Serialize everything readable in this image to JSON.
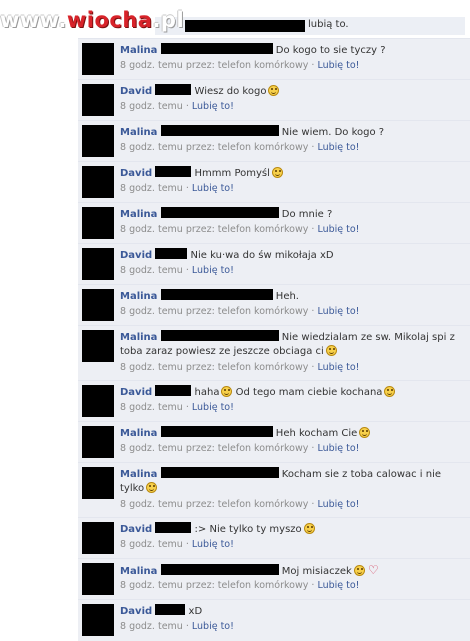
{
  "watermark": {
    "prefix": "www.",
    "brand": "wiocha",
    "suffix": ".pl"
  },
  "top": {
    "text": "lubią to."
  },
  "meta_like": "Lubię to!",
  "comments": [
    {
      "name": "Malina",
      "text": "Do kogo to sie tyczy ?",
      "meta": "8 godz. temu przez: telefon komórkowy ·"
    },
    {
      "name": "David",
      "text": "Wiesz do kogo",
      "meta": "8 godz. temu ·"
    },
    {
      "name": "Malina",
      "text": "Nie wiem. Do kogo ?",
      "meta": "8 godz. temu przez: telefon komórkowy ·"
    },
    {
      "name": "David",
      "text": "Hmmm Pomyśl",
      "meta": "8 godz. temu ·"
    },
    {
      "name": "Malina",
      "text": "Do mnie ?",
      "meta": "8 godz. temu przez: telefon komórkowy ·"
    },
    {
      "name": "David",
      "text": "Nie ku·wa do św mikołaja xD",
      "meta": "8 godz. temu ·"
    },
    {
      "name": "Malina",
      "text": "Heh.",
      "meta": "8 godz. temu przez: telefon komórkowy ·"
    },
    {
      "name": "Malina",
      "text": "Nie wiedzialam ze sw. Mikolaj spi z toba zaraz powiesz ze jeszcze obciaga ci",
      "meta": "8 godz. temu przez: telefon komórkowy ·"
    },
    {
      "name": "David",
      "text": "haha",
      "text2": "Od tego mam ciebie kochana",
      "meta": "8 godz. temu ·"
    },
    {
      "name": "Malina",
      "text": "Heh kocham Cie",
      "meta": "8 godz. temu przez: telefon komórkowy ·"
    },
    {
      "name": "Malina",
      "text": "Kocham sie z toba calowac i nie tylko",
      "meta": "8 godz. temu przez: telefon komórkowy ·"
    },
    {
      "name": "David",
      "text": ":> Nie tylko ty myszo",
      "meta": "8 godz. temu ·"
    },
    {
      "name": "Malina",
      "text": "Moj misiaczek",
      "meta": "8 godz. temu przez: telefon komórkowy ·"
    },
    {
      "name": "David",
      "text": "xD",
      "meta": "8 godz. temu ·"
    }
  ]
}
